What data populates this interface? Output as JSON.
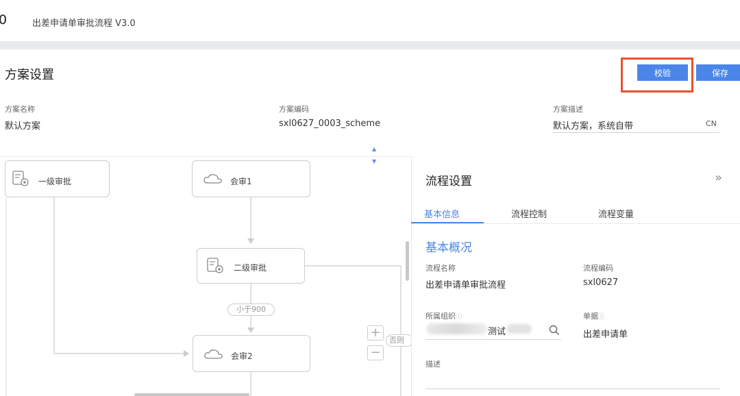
{
  "topbar": {
    "version_fragment": "0",
    "title": "出差申请单审批流程 V3.0"
  },
  "scheme": {
    "title": "方案设置",
    "verify_label": "校验",
    "save_label": "保存",
    "fields": {
      "name_label": "方案名称",
      "name_value": "默认方案",
      "code_label": "方案编码",
      "code_value": "sxl0627_0003_scheme",
      "desc_label": "方案描述",
      "desc_value": "默认方案，系统自带",
      "desc_lang": "CN"
    }
  },
  "canvas": {
    "nodes": {
      "first_approval": "一级审批",
      "countersign1": "会审1",
      "second_approval": "二级审批",
      "countersign2": "会审2"
    },
    "condition_label": "小于900",
    "else_label": "否则",
    "zoom_in": "+",
    "zoom_out": "−"
  },
  "panel": {
    "title": "流程设置",
    "collapse_glyph": "»",
    "tabs": [
      "基本信息",
      "流程控制",
      "流程变量"
    ],
    "active_tab": "基本信息",
    "section_title": "基本概况",
    "process_name_label": "流程名称",
    "process_name_value": "出差申请单审批流程",
    "process_code_label": "流程编码",
    "process_code_value": "sxl0627",
    "org_label": "所属组织",
    "org_value_visible": "测试",
    "doc_label": "单据",
    "doc_value": "出差申请单",
    "remark_label": "描述"
  },
  "colors": {
    "accent": "#4a86e8",
    "highlight": "#e8512a"
  }
}
